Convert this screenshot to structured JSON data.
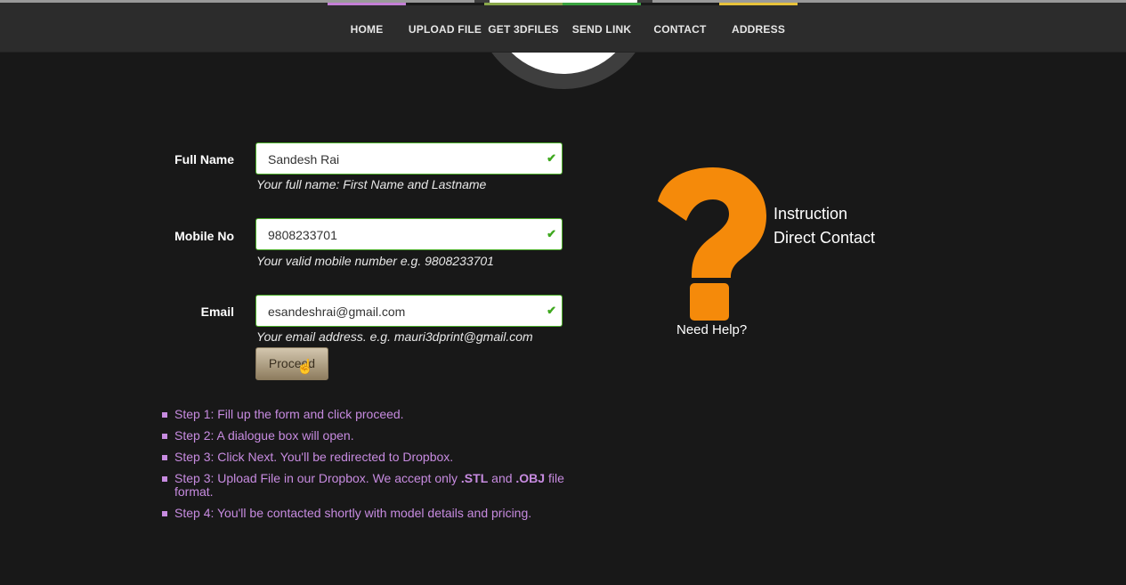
{
  "nav": {
    "items": [
      {
        "label": "HOME",
        "accent": "#c47fd6"
      },
      {
        "label": "UPLOAD FILE",
        "accent": "#1a1a1a"
      },
      {
        "label": "GET 3DFILES",
        "accent": "#8aa84a"
      },
      {
        "label": "SEND LINK",
        "accent": "#3aa340"
      },
      {
        "label": "CONTACT",
        "accent": "#1a1a1a"
      },
      {
        "label": "ADDRESS",
        "accent": "#e8c23a"
      }
    ]
  },
  "form": {
    "full_name": {
      "label": "Full Name",
      "value": "Sandesh Rai",
      "hint": "Your full name: First Name and Lastname"
    },
    "mobile": {
      "label": "Mobile No",
      "value": "9808233701",
      "hint": "Your valid mobile number e.g. 9808233701"
    },
    "email": {
      "label": "Email",
      "value": "esandeshrai@gmail.com",
      "hint": "Your email address. e.g. mauri3dprint@gmail.com"
    },
    "proceed_label": "Proceed",
    "valid_mark": "✔"
  },
  "steps": [
    {
      "text": "Step 1: Fill up the form and click proceed."
    },
    {
      "text": "Step 2: A dialogue box will open."
    },
    {
      "text": "Step 3: Click Next. You'll be redirected to Dropbox."
    },
    {
      "pre": "Step 3: Upload File in our Dropbox. We accept only ",
      "b1": ".STL",
      "mid": " and ",
      "b2": ".OBJ",
      "post": " file format."
    },
    {
      "text": "Step 4: You'll be contacted shortly with model details and pricing."
    }
  ],
  "help": {
    "need_help": "Need Help?",
    "instruction": "Instruction",
    "direct_contact": "Direct Contact",
    "icon": "question-mark-icon",
    "color": "#f58a0a"
  },
  "colors": {
    "background": "#181818",
    "navbar": "#2c2c2c",
    "steps": "#c78be0",
    "valid": "#3ea81e"
  }
}
